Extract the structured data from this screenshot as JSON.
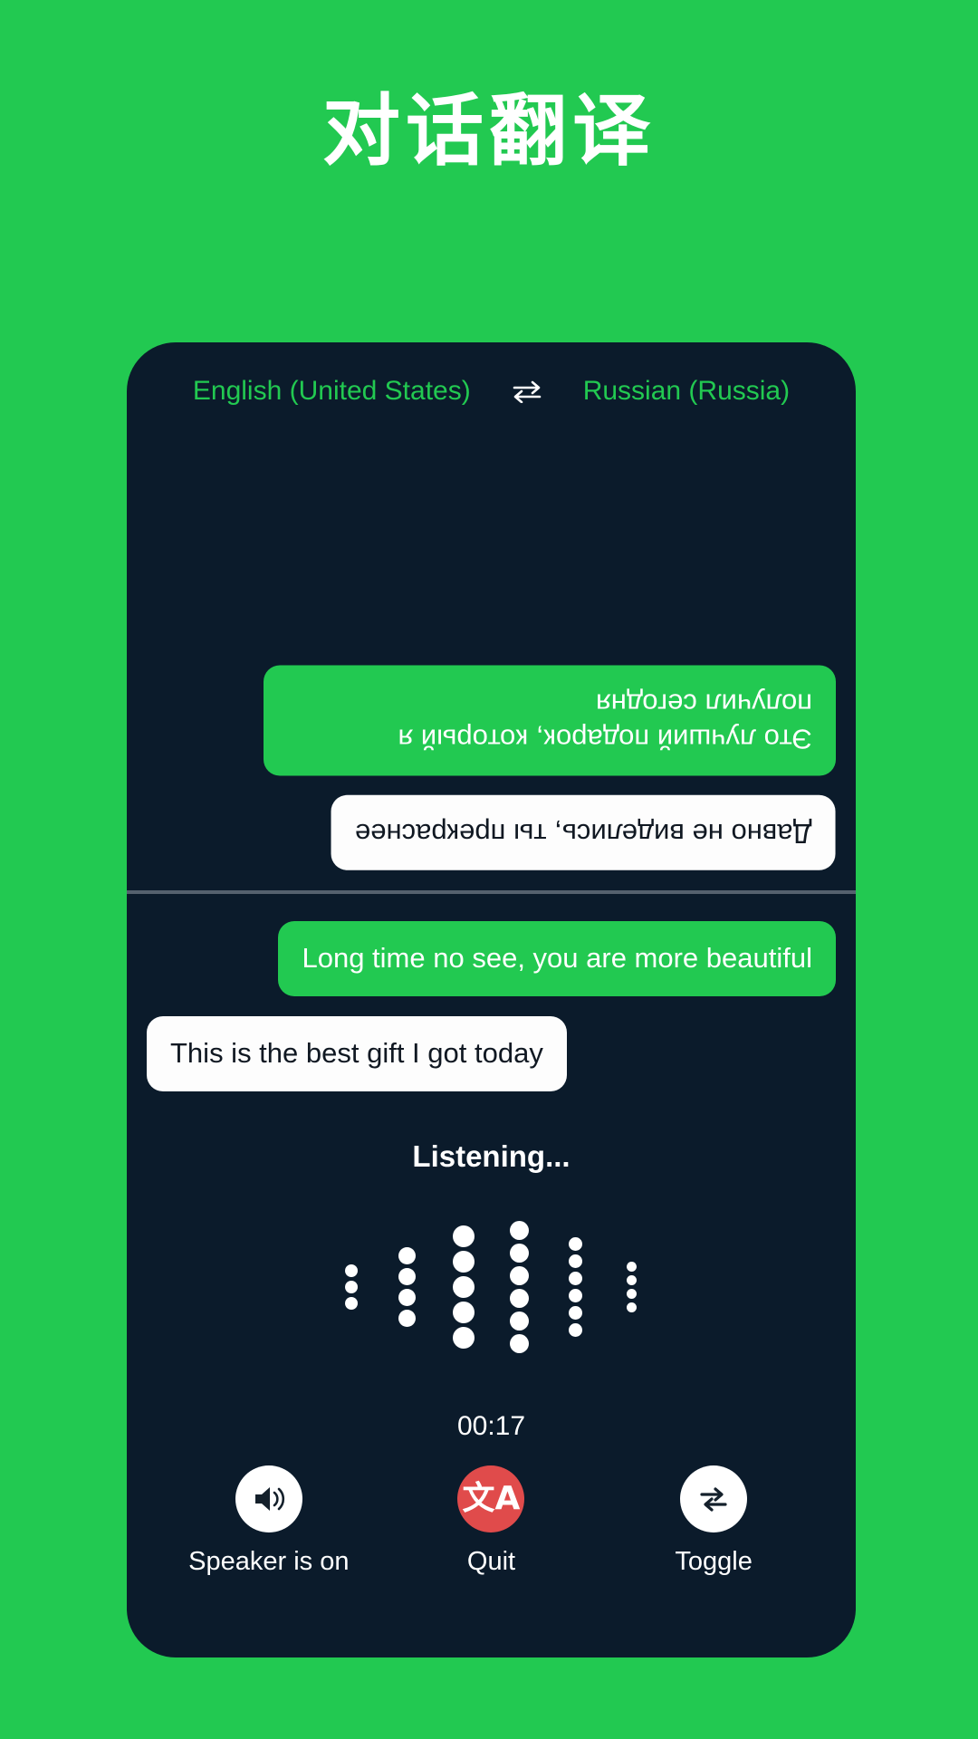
{
  "app": {
    "title": "对话翻译",
    "brand_green": "#22c951",
    "panel_dark": "#0b1b2b",
    "accent_red": "#e04b4b"
  },
  "language_bar": {
    "source_language": "English (United States)",
    "target_language": "Russian (Russia)",
    "swap_icon": "swap-horizontal-icon"
  },
  "conversation": {
    "translated_pane": [
      {
        "side": "right",
        "style": "green",
        "rotated": true,
        "text": "Это лучший подарок, который я получил сегодня"
      },
      {
        "side": "right",
        "style": "white",
        "rotated": true,
        "text": "Давно не виделись, ты прекраснее"
      }
    ],
    "source_pane": [
      {
        "side": "right",
        "style": "green",
        "rotated": false,
        "text": "Long time no see, you are more beautiful"
      },
      {
        "side": "left",
        "style": "white",
        "rotated": false,
        "text": "This is the best gift I got today"
      }
    ]
  },
  "status": {
    "listening_label": "Listening...",
    "timer": "00:17"
  },
  "waveform": {
    "columns": [
      {
        "count": 3,
        "size": 14
      },
      {
        "count": 4,
        "size": 19
      },
      {
        "count": 5,
        "size": 24
      },
      {
        "count": 6,
        "size": 21
      },
      {
        "count": 6,
        "size": 15
      },
      {
        "count": 4,
        "size": 11
      }
    ]
  },
  "controls": [
    {
      "label": "Speaker is on",
      "icon": "speaker-on-icon",
      "variant": "white"
    },
    {
      "label": "Quit",
      "icon": "translate-icon",
      "variant": "red"
    },
    {
      "label": "Toggle",
      "icon": "swap-arrows-icon",
      "variant": "white"
    }
  ]
}
